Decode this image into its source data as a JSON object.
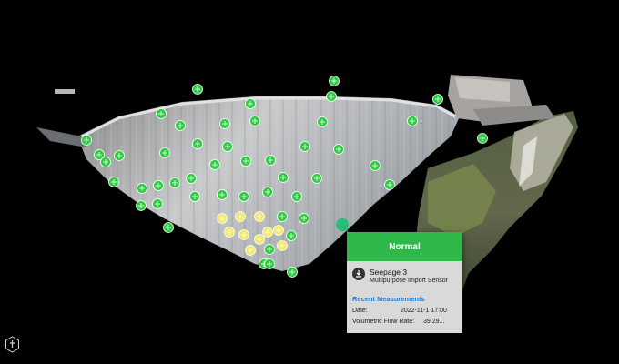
{
  "popup": {
    "status": "Normal",
    "status_color": "#2eb84a",
    "sensor_name": "Seepage 3",
    "sensor_type": "Multipurpose Import Sensor",
    "section_title": "Recent Measurements",
    "rows": [
      {
        "label": "Date:",
        "value": "2022-11-1 17:00"
      },
      {
        "label": "Volumetric Flow Rate:",
        "value": "39.29..."
      }
    ]
  },
  "colors": {
    "sensor_green": "#2ecc40",
    "sensor_yellow": "#f2ea6a",
    "selected": "#1dbf73"
  },
  "icons": {
    "sensor": "crosshair-icon",
    "seepage": "seepage-drop-icon",
    "tool": "building-tool-icon"
  }
}
